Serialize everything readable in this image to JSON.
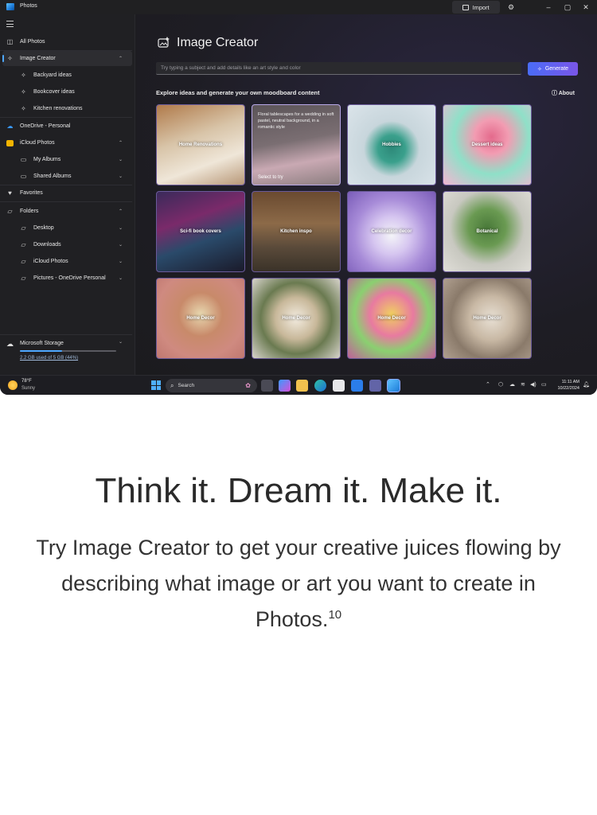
{
  "window": {
    "title": "Photos",
    "import_label": "Import",
    "settings_icon": "gear-icon",
    "minimize": "–",
    "maximize": "▢",
    "close": "✕"
  },
  "sidebar": {
    "items": [
      {
        "label": "All Photos",
        "icon": "image-icon"
      },
      {
        "label": "Image Creator",
        "icon": "sparkle-image-icon",
        "chevron": "⌃"
      },
      {
        "label": "Backyard ideas",
        "icon": "sparkle-image-icon"
      },
      {
        "label": "Bookcover ideas",
        "icon": "sparkle-image-icon"
      },
      {
        "label": "Kitchen renovations",
        "icon": "sparkle-image-icon"
      },
      {
        "label": "OneDrive - Personal",
        "icon": "cloud-icon"
      },
      {
        "label": "iCloud Photos",
        "icon": "icloud-icon",
        "chevron": "⌃"
      },
      {
        "label": "My Albums",
        "icon": "album-icon",
        "chevron": "⌄"
      },
      {
        "label": "Shared Albums",
        "icon": "album-icon",
        "chevron": "⌄"
      },
      {
        "label": "Favorites",
        "icon": "heart-icon"
      },
      {
        "label": "Folders",
        "icon": "folder-icon",
        "chevron": "⌃"
      },
      {
        "label": "Desktop",
        "icon": "folder-icon",
        "chevron": "⌄"
      },
      {
        "label": "Downloads",
        "icon": "folder-icon",
        "chevron": "⌄"
      },
      {
        "label": "iCloud Photos",
        "icon": "folder-icon",
        "chevron": "⌄"
      },
      {
        "label": "Pictures - OneDrive Personal",
        "icon": "folder-icon",
        "chevron": "⌄"
      }
    ],
    "storage": {
      "title": "Microsoft Storage",
      "usage": "2.2 GB used of 5 GB (44%)",
      "fraction": 0.44,
      "chevron": "⌄"
    }
  },
  "main": {
    "title": "Image Creator",
    "prompt_placeholder": "Try typing a subject and add details like an art style and color",
    "generate_label": "Generate",
    "explore_heading": "Explore ideas and generate your own moodboard content",
    "about_label": "About",
    "tiles": [
      {
        "label": "Home Renovations",
        "bg": "linear-gradient(160deg,#b07a4a 0%,#d8c4a8 40%,#efe6d8 70%,#b89878 100%)"
      },
      {
        "label": "",
        "desc": "Floral tablescapes for a wedding in soft pastel, neutral background, in a romantic style",
        "select": "Select to try",
        "bg": "linear-gradient(170deg,#5b5458 0%,#7a6e72 45%,#c9a9b3 70%,#8c7e80 100%)"
      },
      {
        "label": "Hobbies",
        "bg": "radial-gradient(circle at 50% 55%,#2e8a7a 0%,#3aa08c 22%,#c8d6dc 45%,#dbe4ea 100%)"
      },
      {
        "label": "Dessert ideas",
        "bg": "radial-gradient(circle at 55% 40%,#e46a8c 0%,#f29cb2 25%,#8fe0c8 55%,#f3b7d2 100%)"
      },
      {
        "label": "Sci-fi book covers",
        "bg": "linear-gradient(160deg,#3a2a5a 0%,#7a2a6a 35%,#2a4a6a 60%,#1a1a2a 100%)"
      },
      {
        "label": "Kitchen inspo",
        "bg": "linear-gradient(180deg,#6a4a30 0%,#8c6a48 40%,#5a4a3a 70%,#3a3228 100%)"
      },
      {
        "label": "Celebration decor",
        "bg": "radial-gradient(circle at 50% 55%,#f4f4f8 0%,#d6c6f0 30%,#a78bd8 60%,#7a5cb8 100%)"
      },
      {
        "label": "Botanical",
        "bg": "radial-gradient(circle at 50% 45%,#4a7a3a 0%,#6a9a52 30%,#c8c8c0 60%,#e0ded8 100%)"
      },
      {
        "label": "Home Decor",
        "bg": "radial-gradient(circle at 50% 45%,#e8d8b0 0%,#c88a6a 35%,#cf8a80 70%,#c07870 100%)"
      },
      {
        "label": "Home Decor",
        "bg": "radial-gradient(circle at 50% 50%,#f3ece0 0%,#c8b89a 35%,#6a7a50 60%,#d8d4cc 100%)"
      },
      {
        "label": "Home Decor",
        "bg": "radial-gradient(circle at 50% 45%,#f0d060 0%,#e87aa0 35%,#8ad070 60%,#c0609a 100%)"
      },
      {
        "label": "Home Decor",
        "bg": "radial-gradient(circle at 55% 50%,#e8e0d4 0%,#c8b8a4 35%,#8a7a6a 65%,#b0a090 100%)"
      }
    ]
  },
  "taskbar": {
    "weather_temp": "78°F",
    "weather_cond": "Sunny",
    "search_placeholder": "Search",
    "time": "11:11 AM",
    "date": "10/22/2024"
  },
  "marketing": {
    "headline": "Think it. Dream it. Make it.",
    "body": "Try Image Creator to get your creative juices flowing by describing what image or art you want to create in Photos.",
    "footnote": "10"
  }
}
